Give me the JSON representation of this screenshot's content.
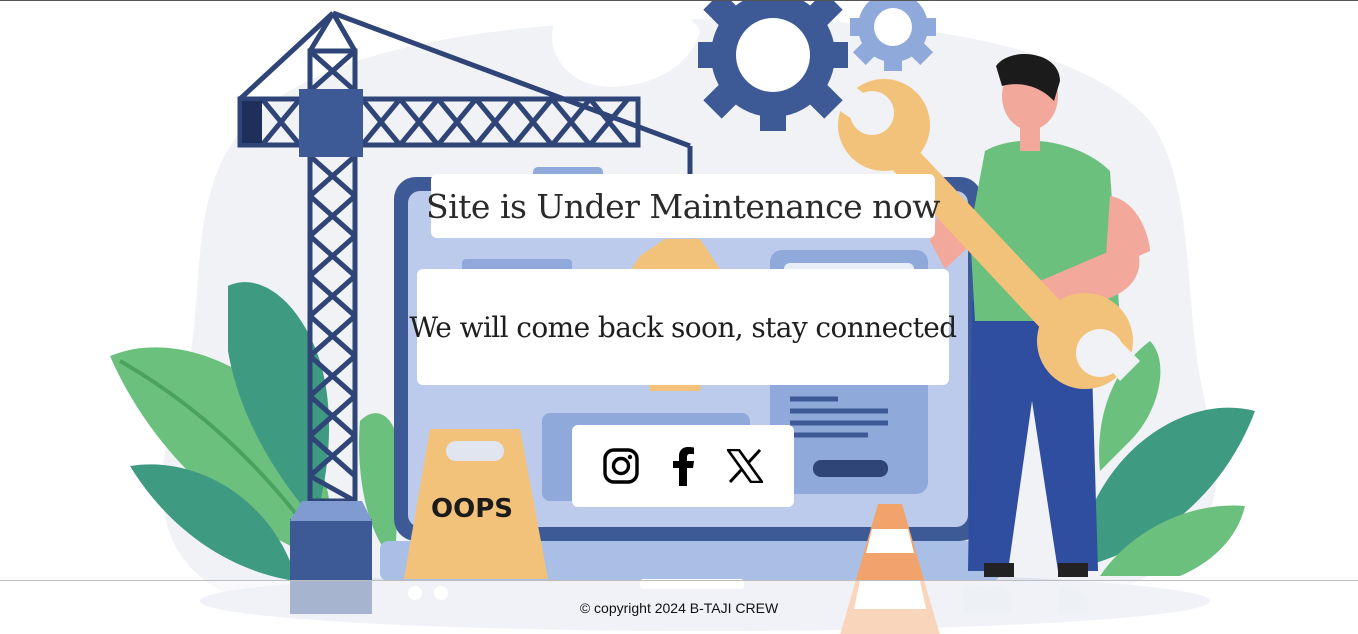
{
  "maintenance": {
    "title": "Site is Under Maintenance now",
    "message": "We will come back soon, stay connected"
  },
  "illustration": {
    "sign_text": "OOPS"
  },
  "social": [
    {
      "name": "instagram",
      "icon": "instagram-icon"
    },
    {
      "name": "facebook",
      "icon": "facebook-icon"
    },
    {
      "name": "x",
      "icon": "x-icon"
    }
  ],
  "footer": {
    "copyright": "© copyright 2024 B-TAJI CREW"
  },
  "colors": {
    "navy": "#3d5a96",
    "green": "#6cc07d",
    "teal": "#3f9a82",
    "wrench": "#f2c27a",
    "screen": "#a9bfe6"
  }
}
